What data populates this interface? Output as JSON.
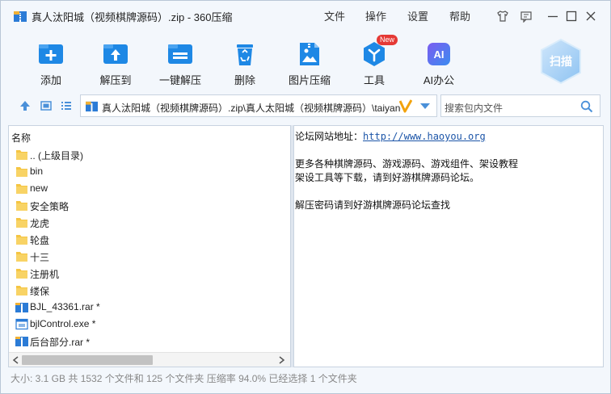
{
  "window": {
    "title": "真人汰阳城（视频棋牌源码）.zip - 360压缩",
    "menus": [
      "文件",
      "操作",
      "设置",
      "帮助"
    ]
  },
  "toolbar": {
    "add": "添加",
    "extract_to": "解压到",
    "one_click_extract": "一键解压",
    "delete": "删除",
    "image_compress": "图片压缩",
    "tools": "工具",
    "tools_badge": "New",
    "ai_office": "AI办公",
    "ai_icon_text": "AI",
    "scan": "扫描"
  },
  "address": {
    "path": "真人汰阳城（视频棋牌源码）.zip\\真人太阳城（视频棋牌源码）\\taiyang"
  },
  "search": {
    "placeholder": "搜索包内文件"
  },
  "file_list": {
    "column_name": "名称",
    "items": [
      {
        "name": ".. (上级目录)",
        "type": "folder"
      },
      {
        "name": "bin",
        "type": "folder"
      },
      {
        "name": "new",
        "type": "folder"
      },
      {
        "name": "安全策略",
        "type": "folder"
      },
      {
        "name": "龙虎",
        "type": "folder"
      },
      {
        "name": "轮盘",
        "type": "folder"
      },
      {
        "name": "十三",
        "type": "folder"
      },
      {
        "name": "注册机",
        "type": "folder"
      },
      {
        "name": "缕保",
        "type": "folder"
      },
      {
        "name": "BJL_43361.rar *",
        "type": "rar"
      },
      {
        "name": "bjlControl.exe *",
        "type": "exe"
      },
      {
        "name": "后台部分.rar *",
        "type": "rar"
      }
    ]
  },
  "note": {
    "line1_label": "论坛网站地址：",
    "line1_link": "http://www.haoyou.org",
    "line2": "更多各种棋牌源码、游戏源码、游戏组件、架设教程",
    "line3": "架设工具等下载，请到好游棋牌源码论坛。",
    "line4": "解压密码请到好游棋牌源码论坛查找"
  },
  "status": {
    "text": "大小: 3.1 GB 共 1532 个文件和 125 个文件夹 压缩率 94.0% 已经选择 1 个文件夹"
  },
  "colors": {
    "accent": "#1e88e5",
    "folder": "#f5c542",
    "badge": "#e53935",
    "link": "#1c55a8"
  }
}
